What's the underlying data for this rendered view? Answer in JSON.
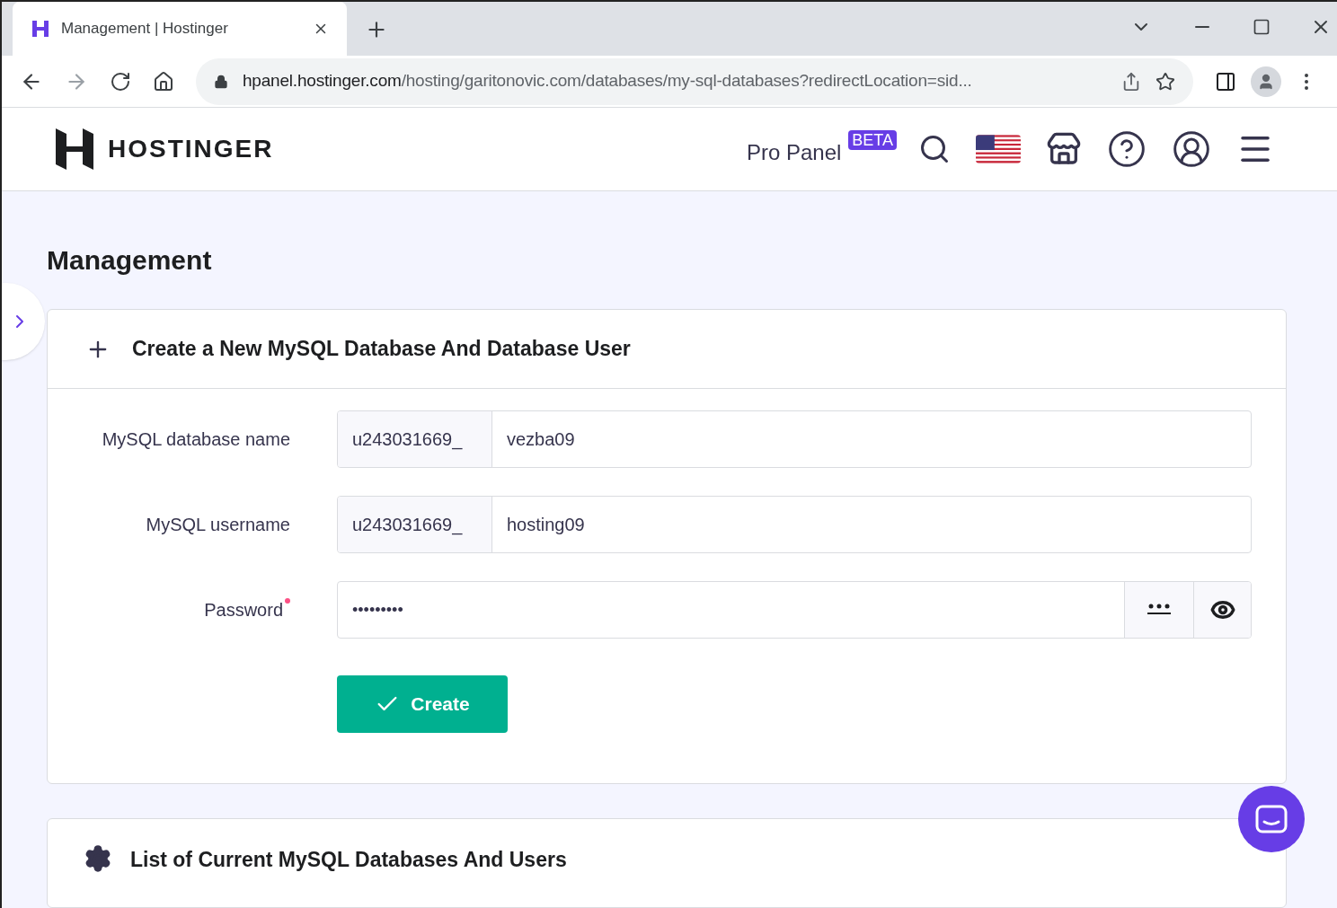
{
  "browser": {
    "tab": {
      "title": "Management | Hostinger"
    },
    "address": {
      "host": "hpanel.hostinger.com",
      "path": "/hosting/garitonovic.com/databases/my-sql-databases?redirectLocation=sid..."
    }
  },
  "header": {
    "logo": "HOSTINGER",
    "pro_panel": "Pro Panel",
    "badge": "BETA"
  },
  "page": {
    "title": "Management"
  },
  "create_section": {
    "title": "Create a New MySQL Database And Database User",
    "fields": [
      {
        "kind": "prefixed",
        "label": "MySQL database name",
        "required": false,
        "prefix": "u243031669_",
        "value": "vezba09"
      },
      {
        "kind": "prefixed",
        "label": "MySQL username",
        "required": false,
        "prefix": "u243031669_",
        "value": "hosting09"
      },
      {
        "kind": "password",
        "label": "Password",
        "required": true,
        "value": "•••••••••"
      }
    ],
    "button": "Create"
  },
  "list_section": {
    "title": "List of Current MySQL Databases And Users"
  }
}
